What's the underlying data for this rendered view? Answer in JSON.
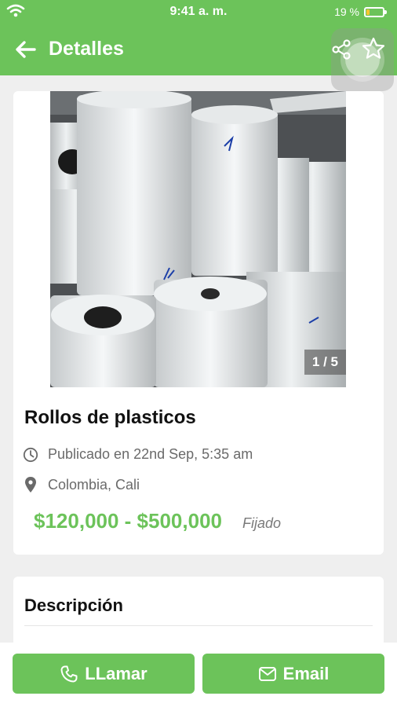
{
  "status_bar": {
    "time": "9:41 a. m.",
    "battery_label": "19 %",
    "battery_level": 0.19
  },
  "app_bar": {
    "title": "Detalles",
    "icons": [
      "back-arrow-icon",
      "share-icon",
      "star-icon"
    ]
  },
  "listing": {
    "image_counter": "1 / 5",
    "title": "Rollos de plasticos",
    "published": "Publicado en 22nd Sep, 5:35 am",
    "location": "Colombia, Cali",
    "price_range": "$120,000 - $500,000",
    "price_type": "Fijado"
  },
  "description": {
    "heading": "Descripción"
  },
  "actions": {
    "call_label": "LLamar",
    "email_label": "Email"
  },
  "colors": {
    "brand_green": "#6cc35a",
    "battery_yellow": "#fbc531"
  }
}
